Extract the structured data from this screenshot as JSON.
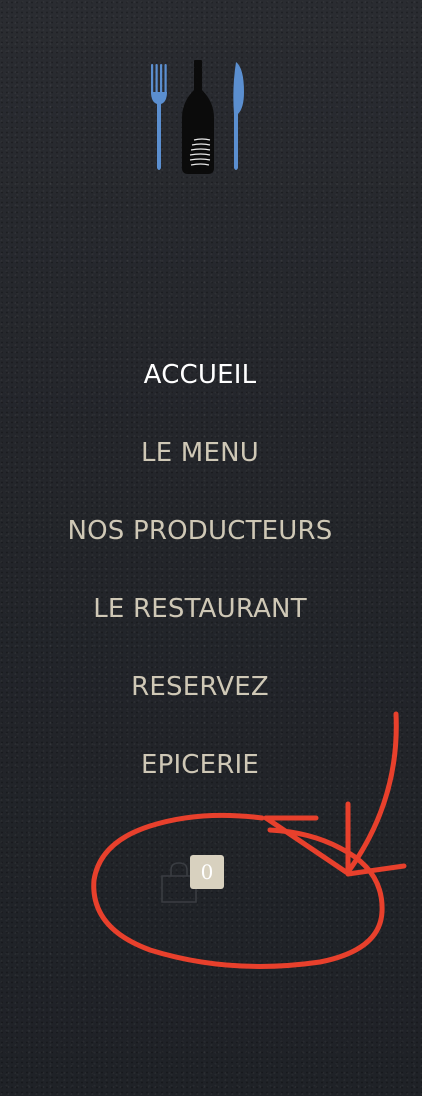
{
  "logo": {
    "icon": "fork-bottle-knife-logo",
    "colors": {
      "cutlery": "#5b8fd0",
      "bottle": "#0b0b0b"
    }
  },
  "menu": {
    "items": [
      {
        "label": "ACCUEIL",
        "active": true
      },
      {
        "label": "LE MENU",
        "active": false
      },
      {
        "label": "NOS PRODUCTEURS",
        "active": false
      },
      {
        "label": "LE RESTAURANT",
        "active": false
      },
      {
        "label": "RESERVEZ",
        "active": false
      },
      {
        "label": "EPICERIE",
        "active": false
      }
    ]
  },
  "cart": {
    "icon": "shopping-bag-icon",
    "count": "0",
    "badge_color": "#d8d1bf"
  },
  "annotation": {
    "color": "#e8402c",
    "shapes": [
      "circle",
      "arrow"
    ]
  },
  "colors": {
    "background": "#26282d",
    "menu_text": "#cfc8b6",
    "active_text": "#ffffff"
  }
}
